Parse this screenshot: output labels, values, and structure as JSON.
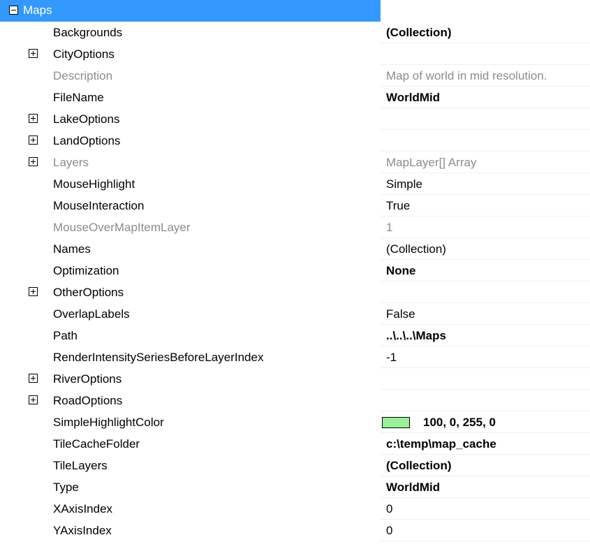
{
  "category": {
    "label": "Maps",
    "expanded": true
  },
  "properties": [
    {
      "name": "Backgrounds",
      "value": "(Collection)",
      "bold": true,
      "expandable": false,
      "disabled": false
    },
    {
      "name": "CityOptions",
      "value": "",
      "bold": false,
      "expandable": true,
      "disabled": false
    },
    {
      "name": "Description",
      "value": "Map of world in mid resolution.",
      "bold": false,
      "expandable": false,
      "disabled": true
    },
    {
      "name": "FileName",
      "value": "WorldMid",
      "bold": true,
      "expandable": false,
      "disabled": false
    },
    {
      "name": "LakeOptions",
      "value": "",
      "bold": false,
      "expandable": true,
      "disabled": false
    },
    {
      "name": "LandOptions",
      "value": "",
      "bold": false,
      "expandable": true,
      "disabled": false
    },
    {
      "name": "Layers",
      "value": "MapLayer[] Array",
      "bold": false,
      "expandable": true,
      "disabled": true
    },
    {
      "name": "MouseHighlight",
      "value": "Simple",
      "bold": false,
      "expandable": false,
      "disabled": false
    },
    {
      "name": "MouseInteraction",
      "value": "True",
      "bold": false,
      "expandable": false,
      "disabled": false
    },
    {
      "name": "MouseOverMapItemLayer",
      "value": "1",
      "bold": false,
      "expandable": false,
      "disabled": true
    },
    {
      "name": "Names",
      "value": "(Collection)",
      "bold": false,
      "expandable": false,
      "disabled": false
    },
    {
      "name": "Optimization",
      "value": "None",
      "bold": true,
      "expandable": false,
      "disabled": false
    },
    {
      "name": "OtherOptions",
      "value": "",
      "bold": false,
      "expandable": true,
      "disabled": false
    },
    {
      "name": "OverlapLabels",
      "value": "False",
      "bold": false,
      "expandable": false,
      "disabled": false
    },
    {
      "name": "Path",
      "value": "..\\..\\..\\Maps",
      "bold": true,
      "expandable": false,
      "disabled": false
    },
    {
      "name": "RenderIntensitySeriesBeforeLayerIndex",
      "value": "-1",
      "bold": false,
      "expandable": false,
      "disabled": false
    },
    {
      "name": "RiverOptions",
      "value": "",
      "bold": false,
      "expandable": true,
      "disabled": false
    },
    {
      "name": "RoadOptions",
      "value": "",
      "bold": false,
      "expandable": true,
      "disabled": false
    },
    {
      "name": "SimpleHighlightColor",
      "value": "100, 0, 255, 0",
      "bold": true,
      "expandable": false,
      "disabled": false,
      "swatch": "#99f099"
    },
    {
      "name": "TileCacheFolder",
      "value": "c:\\temp\\map_cache",
      "bold": true,
      "expandable": false,
      "disabled": false
    },
    {
      "name": "TileLayers",
      "value": "(Collection)",
      "bold": true,
      "expandable": false,
      "disabled": false
    },
    {
      "name": "Type",
      "value": "WorldMid",
      "bold": true,
      "expandable": false,
      "disabled": false
    },
    {
      "name": "XAxisIndex",
      "value": "0",
      "bold": false,
      "expandable": false,
      "disabled": false
    },
    {
      "name": "YAxisIndex",
      "value": "0",
      "bold": false,
      "expandable": false,
      "disabled": false
    }
  ],
  "colors": {
    "selection": "#3399ff",
    "disabled_text": "#8c8c8c"
  },
  "icons": {
    "collapse": "minus-box-icon",
    "expand": "plus-box-icon"
  }
}
